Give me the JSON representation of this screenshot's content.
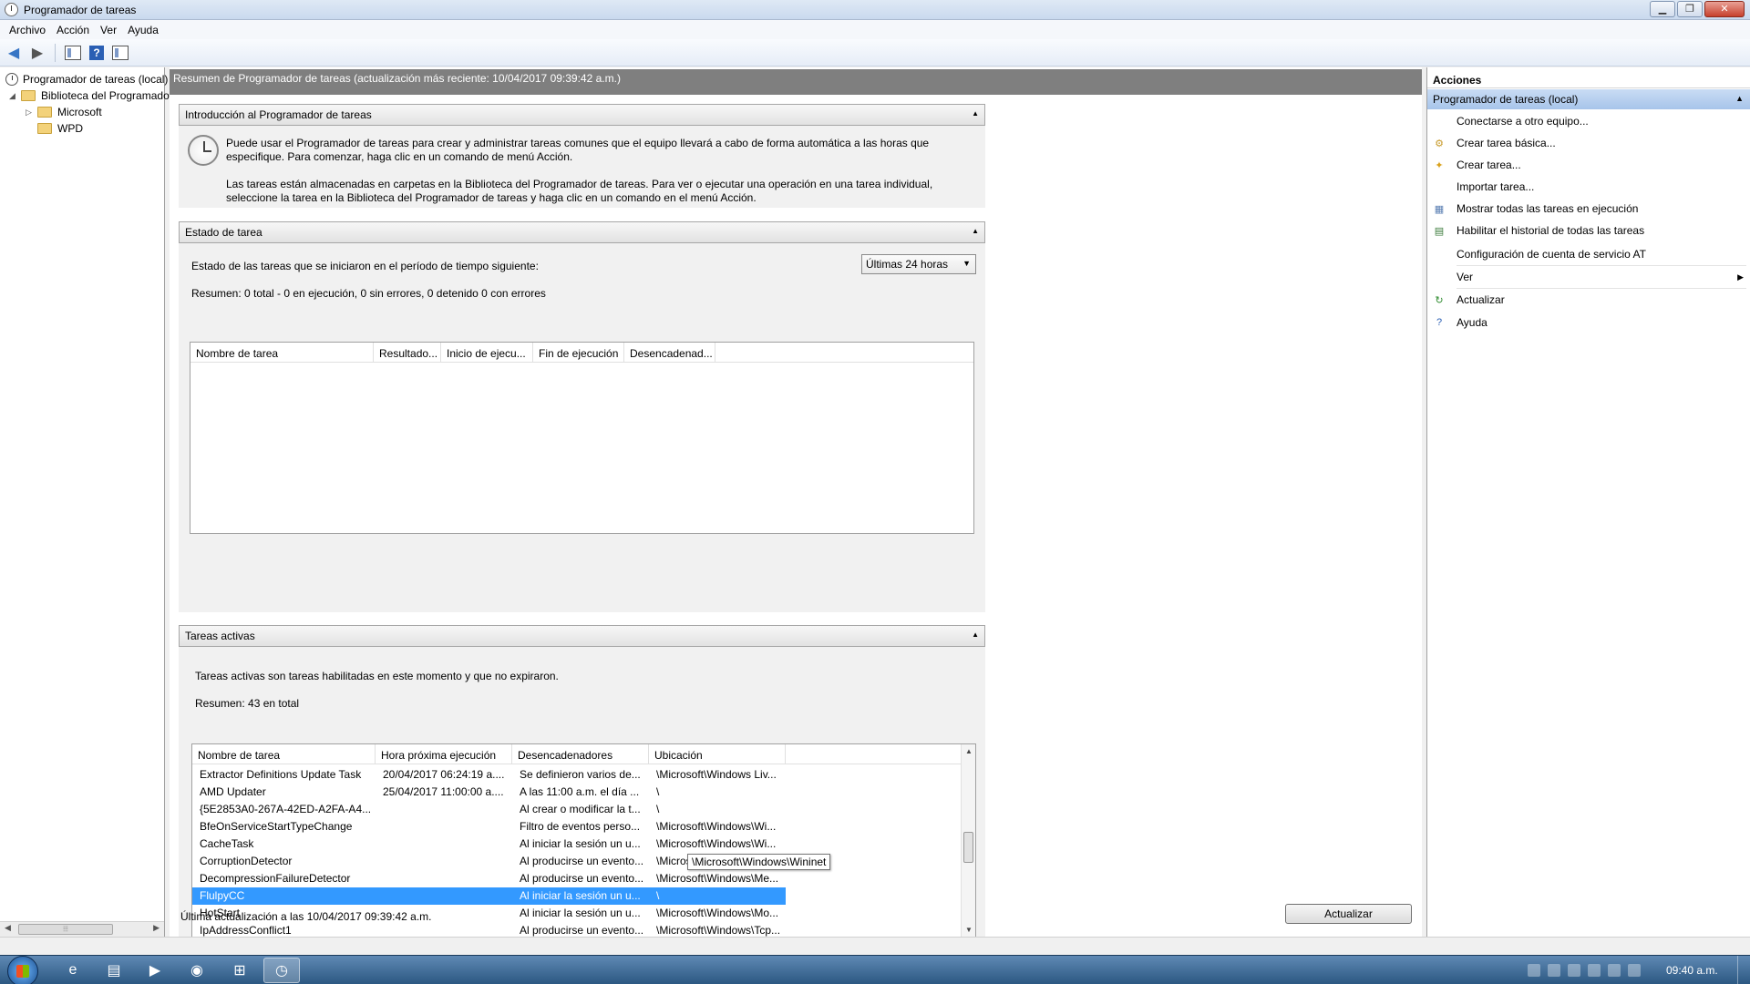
{
  "window": {
    "title": "Programador de tareas",
    "buttons": {
      "minimize": "▁",
      "maximize": "❐",
      "close": "✕"
    }
  },
  "menubar": [
    "Archivo",
    "Acción",
    "Ver",
    "Ayuda"
  ],
  "tree": {
    "root": "Programador de tareas (local)",
    "library": "Biblioteca del Programador de tareas",
    "children": [
      "Microsoft",
      "WPD"
    ]
  },
  "center": {
    "header": "Resumen de Programador de tareas (actualización más reciente: 10/04/2017 09:39:42 a.m.)",
    "intro": {
      "title": "Introducción al Programador de tareas",
      "p1": "Puede usar el Programador de tareas para crear y administrar tareas comunes que el equipo llevará a cabo de forma automática a las horas que especifique. Para comenzar, haga clic en un comando de menú Acción.",
      "p2": "Las tareas están almacenadas en carpetas en la Biblioteca del Programador de tareas. Para ver o ejecutar una operación en una tarea individual, seleccione la tarea en la Biblioteca del Programador de tareas y haga clic en un comando en el menú Acción."
    },
    "status": {
      "title": "Estado de tarea",
      "period_label": "Estado de las tareas que se iniciaron en el período de tiempo siguiente:",
      "period_value": "Últimas 24 horas",
      "summary": "Resumen: 0 total - 0 en ejecución, 0 sin errores, 0 detenido  0 con errores",
      "columns": [
        "Nombre de tarea",
        "Resultado...",
        "Inicio de ejecu...",
        "Fin de ejecución",
        "Desencadenad..."
      ]
    },
    "active": {
      "title": "Tareas activas",
      "description": "Tareas activas son tareas habilitadas en este momento y que no expiraron.",
      "summary": "Resumen: 43 en total",
      "columns": [
        "Nombre de tarea",
        "Hora próxima ejecución",
        "Desencadenadores",
        "Ubicación"
      ],
      "rows": [
        {
          "name": "Extractor Definitions Update Task",
          "next": "20/04/2017 06:24:19 a....",
          "triggers": "Se definieron varios de...",
          "location": "\\Microsoft\\Windows Liv...",
          "selected": false
        },
        {
          "name": "AMD Updater",
          "next": "25/04/2017 11:00:00 a....",
          "triggers": "A las 11:00 a.m. el día ...",
          "location": "\\",
          "selected": false
        },
        {
          "name": "{5E2853A0-267A-42ED-A2FA-A4...",
          "next": "",
          "triggers": "Al crear o modificar la t...",
          "location": "\\",
          "selected": false
        },
        {
          "name": "BfeOnServiceStartTypeChange",
          "next": "",
          "triggers": "Filtro de eventos perso...",
          "location": "\\Microsoft\\Windows\\Wi...",
          "selected": false
        },
        {
          "name": "CacheTask",
          "next": "",
          "triggers": "Al iniciar la sesión un u...",
          "location": "\\Microsoft\\Windows\\Wi...",
          "selected": false
        },
        {
          "name": "CorruptionDetector",
          "next": "",
          "triggers": "Al producirse un evento...",
          "location": "\\Micros",
          "selected": false
        },
        {
          "name": "DecompressionFailureDetector",
          "next": "",
          "triggers": "Al producirse un evento...",
          "location": "\\Microsoft\\Windows\\Me...",
          "selected": false
        },
        {
          "name": "FlulpyCC",
          "next": "",
          "triggers": "Al iniciar la sesión un u...",
          "location": "\\",
          "selected": true
        },
        {
          "name": "HotStart",
          "next": "",
          "triggers": "Al iniciar la sesión un u...",
          "location": "\\Microsoft\\Windows\\Mo...",
          "selected": false
        },
        {
          "name": "IpAddressConflict1",
          "next": "",
          "triggers": "Al producirse un evento...",
          "location": "\\Microsoft\\Windows\\Tcp...",
          "selected": false
        }
      ],
      "tooltip": "\\Microsoft\\Windows\\Wininet"
    },
    "last_update": "Última actualización a las 10/04/2017 09:39:42 a.m.",
    "refresh_button": "Actualizar"
  },
  "actions": {
    "title": "Acciones",
    "group": "Programador de tareas (local)",
    "items": [
      {
        "label": "Conectarse a otro equipo...",
        "icon": "none"
      },
      {
        "label": "Crear tarea básica...",
        "icon": "wizard-icon"
      },
      {
        "label": "Crear tarea...",
        "icon": "new-task-icon"
      },
      {
        "label": "Importar tarea...",
        "icon": "none"
      },
      {
        "label": "Mostrar todas las tareas en ejecución",
        "icon": "running-tasks-icon"
      },
      {
        "label": "Habilitar el historial de todas las tareas",
        "icon": "history-icon"
      },
      {
        "label": "Configuración de cuenta de servicio AT",
        "icon": "none"
      },
      {
        "label": "Ver",
        "icon": "none"
      },
      {
        "label": "Actualizar",
        "icon": "refresh-icon"
      },
      {
        "label": "Ayuda",
        "icon": "help-icon"
      }
    ]
  },
  "taskbar": {
    "clock": "09:40 a.m."
  },
  "colors": {
    "selection": "#3399ff",
    "header_gray": "#7f7f7f",
    "actions_group": "#b8d0ee"
  }
}
